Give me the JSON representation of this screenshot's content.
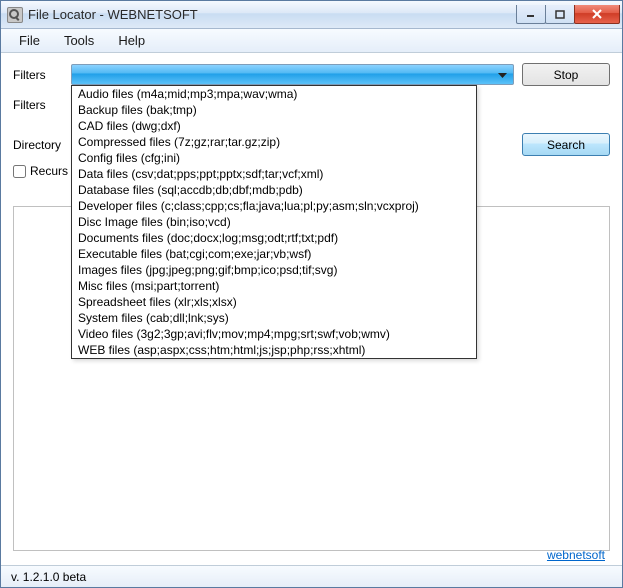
{
  "window": {
    "title": "File Locator - WEBNETSOFT"
  },
  "menu": {
    "file": "File",
    "tools": "Tools",
    "help": "Help"
  },
  "labels": {
    "filters1": "Filters",
    "filters2": "Filters",
    "directory": "Directory",
    "recurse": "Recurs"
  },
  "buttons": {
    "stop": "Stop",
    "search": "Search"
  },
  "dropdown_items": [
    "Audio files (m4a;mid;mp3;mpa;wav;wma)",
    "Backup files (bak;tmp)",
    "CAD files (dwg;dxf)",
    "Compressed files (7z;gz;rar;tar.gz;zip)",
    "Config files (cfg;ini)",
    "Data files (csv;dat;pps;ppt;pptx;sdf;tar;vcf;xml)",
    "Database files (sql;accdb;db;dbf;mdb;pdb)",
    "Developer files (c;class;cpp;cs;fla;java;lua;pl;py;asm;sln;vcxproj)",
    "Disc Image files (bin;iso;vcd)",
    "Documents files (doc;docx;log;msg;odt;rtf;txt;pdf)",
    "Executable files (bat;cgi;com;exe;jar;vb;wsf)",
    "Images files (jpg;jpeg;png;gif;bmp;ico;psd;tif;svg)",
    "Misc files (msi;part;torrent)",
    "Spreadsheet files (xlr;xls;xlsx)",
    "System files (cab;dll;lnk;sys)",
    "Video files (3g2;3gp;avi;flv;mov;mp4;mpg;srt;swf;vob;wmv)",
    "WEB files (asp;aspx;css;htm;html;js;jsp;php;rss;xhtml)"
  ],
  "status": {
    "version": "v. 1.2.1.0 beta",
    "link": "webnetsoft"
  }
}
